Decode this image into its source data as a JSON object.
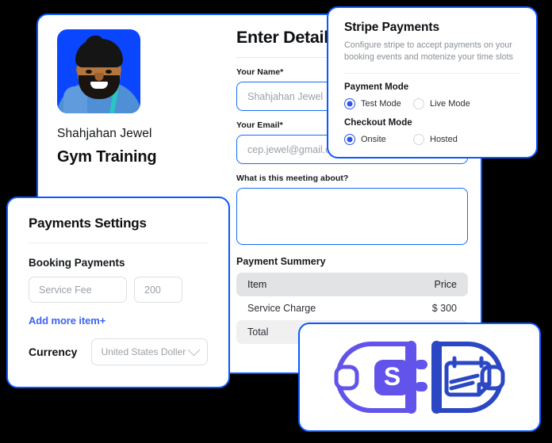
{
  "profile": {
    "avatar_icon": "user-photo-avatar",
    "name": "Shahjahan Jewel",
    "title": "Gym Training"
  },
  "booking_form": {
    "heading": "Enter Details",
    "fields": [
      {
        "label": "Your Name*",
        "placeholder": "Shahjahan Jewel",
        "value": ""
      },
      {
        "label": "Your Email*",
        "placeholder": "cep.jewel@gmail.com",
        "value": ""
      }
    ],
    "message": {
      "label": "What is this meeting about?",
      "value": "",
      "placeholder": ""
    },
    "summary": {
      "title": "Payment Summery",
      "columns": [
        "Item",
        "Price"
      ],
      "rows": [
        {
          "item": "Service Charge",
          "price": "$ 300"
        },
        {
          "item": "Total",
          "price": ""
        }
      ]
    }
  },
  "stripe_card": {
    "title": "Stripe Payments",
    "description": "Configure stripe to accept payments on your booking events and motenize your time slots",
    "payment_mode": {
      "label": "Payment Mode",
      "options": [
        {
          "label": "Test Mode",
          "selected": true
        },
        {
          "label": "Live Mode",
          "selected": false
        }
      ]
    },
    "checkout_mode": {
      "label": "Checkout Mode",
      "options": [
        {
          "label": "Onsite",
          "selected": true
        },
        {
          "label": "Hosted",
          "selected": false
        }
      ]
    }
  },
  "payments_settings": {
    "title": "Payments Settings",
    "booking_payments_label": "Booking Payments",
    "fee_name_placeholder": "Service Fee",
    "fee_amount": "200",
    "add_more_label": "Add more item+",
    "currency_label": "Currency",
    "currency_value": "United States Doller",
    "chevron_icon": "chevron-down-icon"
  },
  "integration_logo": {
    "plug_icon": "stripe-plug-icon",
    "socket_icon": "booking-calendar-socket-icon",
    "stripe_glyph": "S"
  },
  "colors": {
    "accent_blue": "#0a58ff",
    "link_blue": "#3c63f0",
    "radio_blue": "#2e55e6",
    "stripe_purple": "#6253ea",
    "socket_blue": "#2b47c4",
    "avatar_bg": "#0b46ff",
    "background": "#000000"
  }
}
